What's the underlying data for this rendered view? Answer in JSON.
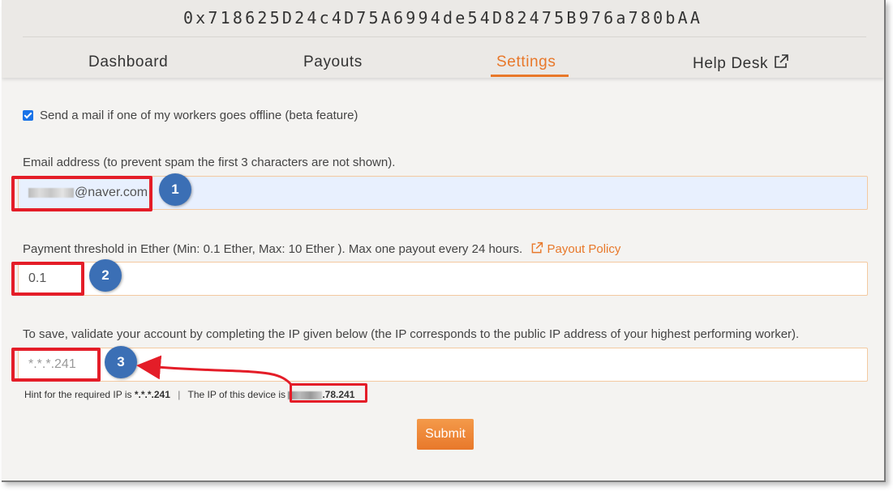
{
  "header": {
    "wallet_address": "0x718625D24c4D75A6994de54D82475B976a780bAA",
    "nav": [
      {
        "label": "Dashboard",
        "active": false
      },
      {
        "label": "Payouts",
        "active": false
      },
      {
        "label": "Settings",
        "active": true
      },
      {
        "label": "Help Desk",
        "active": false,
        "external": true
      }
    ]
  },
  "settings": {
    "offline_mail_checkbox": {
      "label": "Send a mail if one of my workers goes offline (beta feature)",
      "checked": true
    },
    "email": {
      "label": "Email address (to prevent spam the first 3 characters are not shown).",
      "value": "@naver.com"
    },
    "threshold": {
      "label": "Payment threshold in Ether (Min: 0.1 Ether, Max: 10 Ether ). Max one payout every 24 hours.",
      "link_label": "Payout Policy",
      "value": "0.1"
    },
    "ip": {
      "label": "To save, validate your account by completing the IP given below (the IP corresponds to the public IP address of your highest performing worker).",
      "placeholder": "*.*.*.241"
    },
    "hint": {
      "prefix": "Hint for the required IP is ",
      "required_ip": "*.*.*.241",
      "separator": "|",
      "device_prefix": "The IP of this device is ",
      "device_ip_suffix": ".78.241"
    },
    "submit_label": "Submit"
  },
  "annotations": {
    "badges": [
      "1",
      "2",
      "3"
    ],
    "highlight_color": "#e41d28",
    "badge_color": "#3b6fb5"
  },
  "colors": {
    "accent": "#e8782a",
    "background": "#f4f3f1",
    "header": "#ebe9e6"
  }
}
